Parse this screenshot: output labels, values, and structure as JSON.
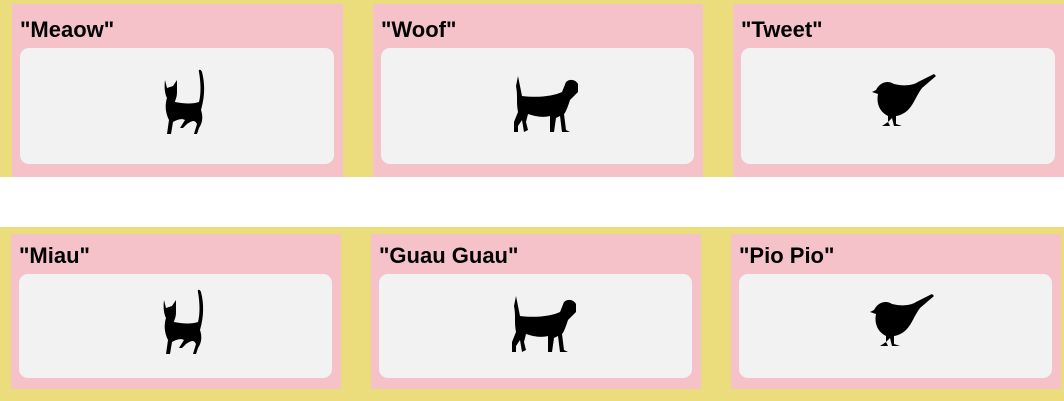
{
  "colors": {
    "background": "#ebdd7c",
    "card": "#f5c2ca",
    "image_box": "#f2f2f2"
  },
  "rows": [
    {
      "cards": [
        {
          "label": "\"Meaow\"",
          "icon": "cat-icon"
        },
        {
          "label": "\"Woof\"",
          "icon": "dog-icon"
        },
        {
          "label": "\"Tweet\"",
          "icon": "bird-icon"
        }
      ]
    },
    {
      "cards": [
        {
          "label": "\"Miau\"",
          "icon": "cat-icon"
        },
        {
          "label": "\"Guau Guau\"",
          "icon": "dog-icon"
        },
        {
          "label": "\"Pio Pio\"",
          "icon": "bird-icon"
        }
      ]
    }
  ]
}
